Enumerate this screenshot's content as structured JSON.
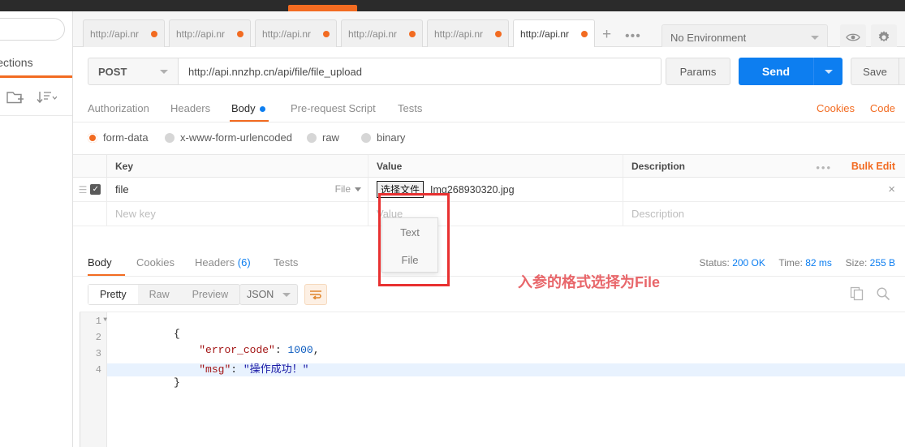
{
  "sidebar": {
    "tab_label": "llections",
    "search_placeholder": "",
    "new_folder_icon": "new-folder-icon",
    "sort_icon": "sort-icon"
  },
  "tabbar": {
    "tabs": [
      {
        "label": "http://api.nr",
        "unsaved": true,
        "active": false
      },
      {
        "label": "http://api.nr",
        "unsaved": true,
        "active": false
      },
      {
        "label": "http://api.nr",
        "unsaved": true,
        "active": false
      },
      {
        "label": "http://api.nr",
        "unsaved": true,
        "active": false
      },
      {
        "label": "http://api.nr",
        "unsaved": true,
        "active": false
      },
      {
        "label": "http://api.nr",
        "unsaved": true,
        "active": true
      }
    ],
    "new_tab_label": "+",
    "more_label": "•••"
  },
  "environment": {
    "selected": "No Environment",
    "eye_icon": "eye-icon",
    "settings_icon": "gear-icon"
  },
  "request": {
    "method": "POST",
    "url": "http://api.nnzhp.cn/api/file/file_upload",
    "params_label": "Params",
    "send_label": "Send",
    "save_label": "Save",
    "tabs": [
      {
        "label": "Authorization",
        "active": false,
        "dot": false
      },
      {
        "label": "Headers",
        "active": false,
        "dot": false
      },
      {
        "label": "Body",
        "active": true,
        "dot": true
      },
      {
        "label": "Pre-request Script",
        "active": false,
        "dot": false
      },
      {
        "label": "Tests",
        "active": false,
        "dot": false
      }
    ],
    "links": [
      {
        "label": "Cookies"
      },
      {
        "label": "Code"
      }
    ],
    "body_types": [
      {
        "label": "form-data",
        "selected": true
      },
      {
        "label": "x-www-form-urlencoded",
        "selected": false
      },
      {
        "label": "raw",
        "selected": false
      },
      {
        "label": "binary",
        "selected": false
      }
    ]
  },
  "form_data": {
    "headers": [
      "Key",
      "Value",
      "Description"
    ],
    "more_label": "•••",
    "bulk_edit_label": "Bulk Edit",
    "rows": [
      {
        "checked": true,
        "key": "file",
        "type": "File",
        "file_button_label": "选择文件",
        "file_name": "Img268930320.jpg",
        "description": "",
        "remove_label": "×"
      }
    ],
    "new_row": {
      "key_placeholder": "New key",
      "value_placeholder": "Value",
      "description_placeholder": "Description"
    },
    "type_dropdown": {
      "open": true,
      "options": [
        "Text",
        "File"
      ]
    }
  },
  "annotation": {
    "text": "入参的格式选择为File",
    "color": "#e8666a",
    "box_color": "#e83030"
  },
  "response": {
    "tabs": [
      {
        "label": "Body",
        "active": true,
        "count": ""
      },
      {
        "label": "Cookies",
        "active": false,
        "count": ""
      },
      {
        "label": "Headers",
        "active": false,
        "count": "(6)"
      },
      {
        "label": "Tests",
        "active": false,
        "count": ""
      }
    ],
    "status_label": "Status:",
    "status_value": "200 OK",
    "time_label": "Time:",
    "time_value": "82 ms",
    "size_label": "Size:",
    "size_value": "255 B",
    "view_modes": [
      {
        "label": "Pretty",
        "active": true
      },
      {
        "label": "Raw",
        "active": false
      },
      {
        "label": "Preview",
        "active": false
      }
    ],
    "format": "JSON",
    "wrap_icon": "word-wrap-icon",
    "copy_icon": "copy-icon",
    "search_icon": "search-icon",
    "code_lines": [
      {
        "num": "1",
        "fold": true,
        "text": "{"
      },
      {
        "num": "2",
        "fold": false,
        "text": "    \"error_code\": 1000,"
      },
      {
        "num": "3",
        "fold": false,
        "text": "    \"msg\": \"操作成功！\""
      },
      {
        "num": "4",
        "fold": false,
        "text": "}"
      }
    ],
    "json": {
      "error_code": "1000",
      "error_code_key": "\"error_code\"",
      "msg_key": "\"msg\"",
      "msg_value": "\"操作成功！\"",
      "open_brace": "{",
      "close_brace": "}",
      "colon1": ": ",
      "comma": ",",
      "colon2": ": "
    }
  },
  "colors": {
    "accent_orange": "#f26b21",
    "send_blue": "#0d7ef0",
    "annotation_red": "#e83030"
  }
}
